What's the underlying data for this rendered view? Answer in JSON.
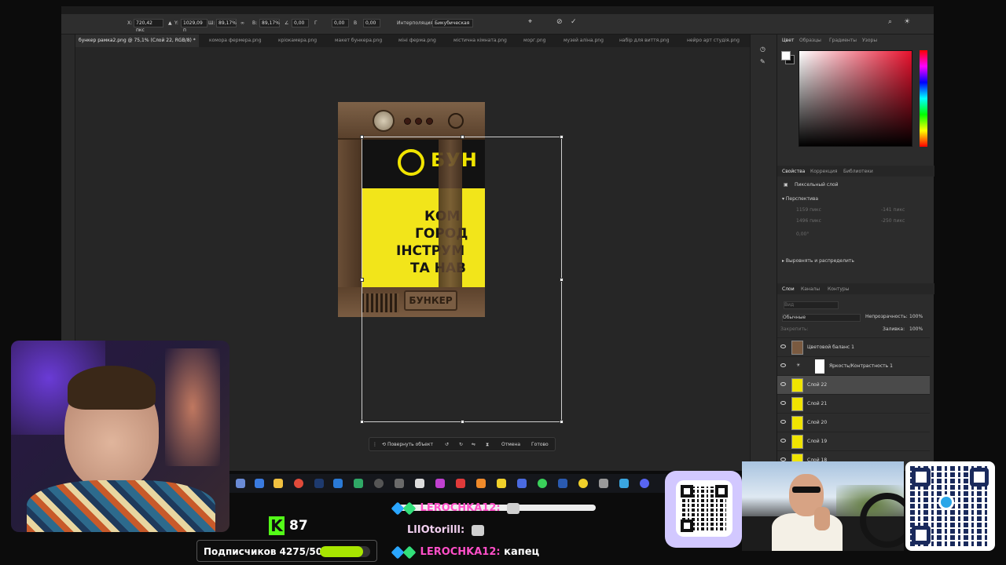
{
  "photoshop": {
    "options_bar": {
      "x_label": "X:",
      "x_value": "720,42 пкс",
      "y_label": "Y:",
      "y_value": "1029,09 п",
      "w_label": "Ш:",
      "w_value": "89,17%",
      "h_label": "В:",
      "h_value": "89,17%",
      "angle_value": "0,00",
      "skew_h_value": "0,00",
      "skew_v_value": "0,00",
      "interp_label": "Интерполяция:",
      "interp_value": "Бикубическая"
    },
    "tabs": [
      "бункер рамка2.png @ 75,1% (Слой 22, RGB/8) *",
      "комора фермера.png",
      "кріокамера.png",
      "макет бункера.png",
      "міні ферма.png",
      "містична кімната.png",
      "морг.png",
      "музей аліна.png",
      "набір для виття.png",
      "нейро арт студія.png"
    ],
    "artwork": {
      "logo_text": "БУН",
      "lines": [
        "КОМ",
        "ГОРОД",
        "ІНСТРУМ",
        "ТА НАВ"
      ],
      "plate_text": "БУНКЕР"
    },
    "context_bar": {
      "rotate_label": "Повернуть объект",
      "cancel_label": "Отмена",
      "done_label": "Готово"
    },
    "color_panel": {
      "tabs": [
        "Цвет",
        "Образцы",
        "Градиенты",
        "Узоры"
      ]
    },
    "properties_panel": {
      "tabs": [
        "Свойства",
        "Коррекция",
        "Библиотеки"
      ],
      "layer_type": "Пиксельный слой",
      "section_perspective": "Перспектива",
      "w_value": "1159 пикс",
      "x_value": "-141 пикс",
      "h_value": "1496 пикс",
      "y_value": "-250 пикс",
      "angle_value": "0,00°",
      "section_align": "Выровнять и распределить"
    },
    "layers_panel": {
      "tabs": [
        "Слои",
        "Каналы",
        "Контуры"
      ],
      "search_placeholder": "Вид",
      "blend_mode": "Обычные",
      "opacity_label": "Непрозрачность:",
      "opacity_value": "100%",
      "lock_label": "Закрепить:",
      "fill_label": "Заливка:",
      "fill_value": "100%",
      "layers": [
        {
          "name": "Цветовой баланс 1",
          "selected": false,
          "thumb": "brown"
        },
        {
          "name": "Яркость/Контрастность 1",
          "selected": false,
          "thumb": "adjust"
        },
        {
          "name": "Слой 22",
          "selected": true,
          "thumb": "yellow"
        },
        {
          "name": "Слой 21",
          "selected": false,
          "thumb": "yellow"
        },
        {
          "name": "Слой 20",
          "selected": false,
          "thumb": "yellow"
        },
        {
          "name": "Слой 19",
          "selected": false,
          "thumb": "yellow"
        },
        {
          "name": "Слой 18",
          "selected": false,
          "thumb": "yellow"
        }
      ]
    }
  },
  "stream": {
    "kick_count": "87",
    "followers_text": "Подписчиков 4275/5000",
    "followers_progress": 0.855,
    "chat": [
      {
        "nick": "LEROCHKA12:",
        "message": "",
        "nick_style": "pink",
        "emote": true
      },
      {
        "nick": "LlIOtorilll:",
        "message": "",
        "nick_style": "light",
        "emote": true
      },
      {
        "nick": "LEROCHKA12:",
        "message": "капец",
        "nick_style": "pink",
        "emote": false
      }
    ]
  },
  "colors": {
    "ps_bg": "#262626",
    "accent_yellow": "#f2e51a",
    "kick_green": "#53fc18",
    "progress_green": "#a8e600"
  }
}
